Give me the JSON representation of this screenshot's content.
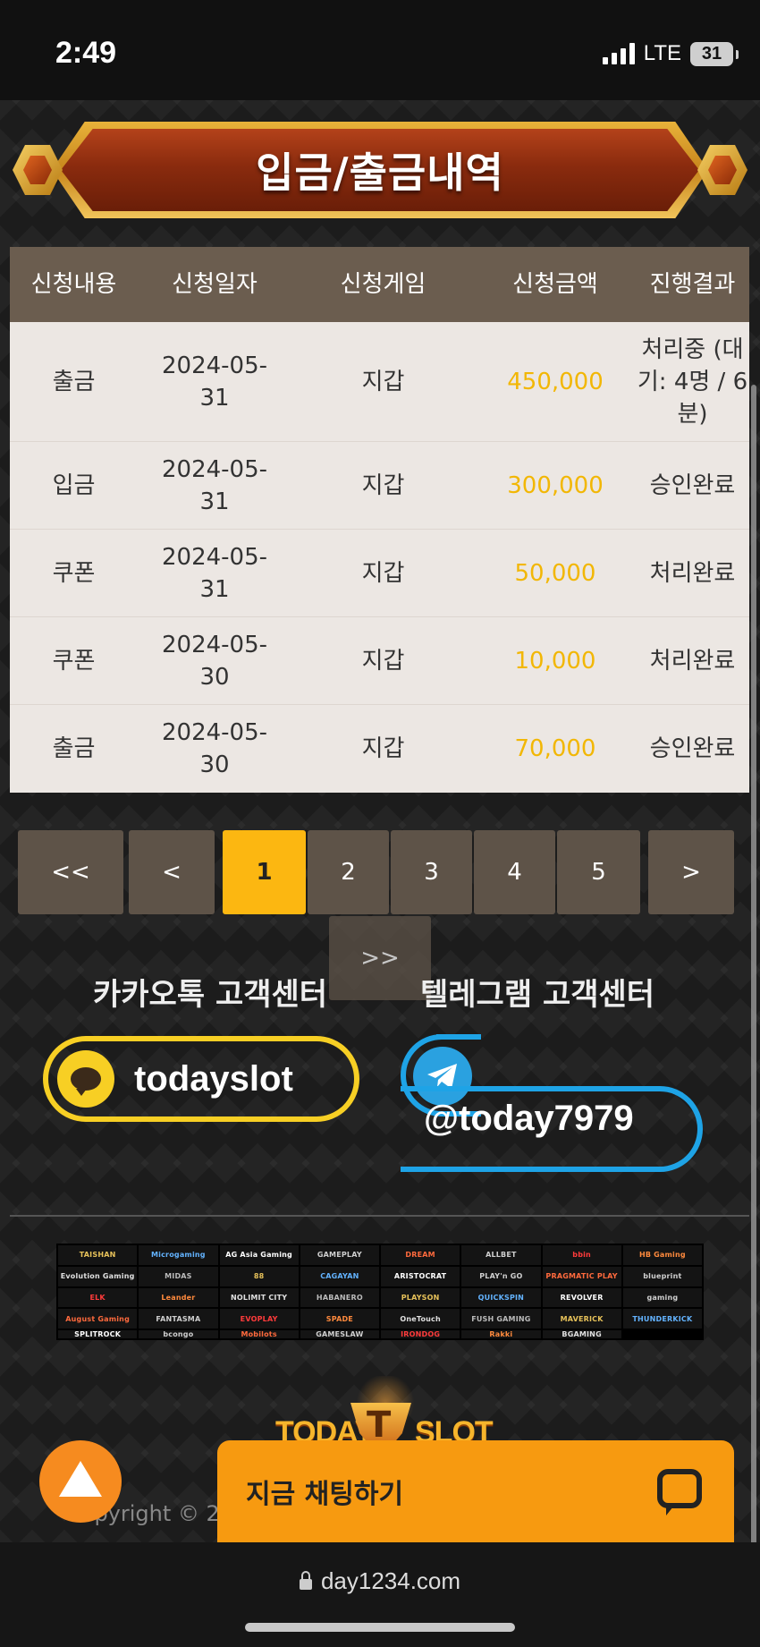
{
  "status": {
    "time": "2:49",
    "network": "LTE",
    "battery": "31"
  },
  "banner": {
    "title": "입금/출금내역"
  },
  "table": {
    "headers": [
      "신청내용",
      "신청일자",
      "신청게임",
      "신청금액",
      "진행결과"
    ],
    "rows": [
      {
        "type": "출금",
        "date": "2024-05-31",
        "game": "지갑",
        "amount": "450,000",
        "result": "처리중 (대기: 4명 / 6분)"
      },
      {
        "type": "입금",
        "date": "2024-05-31",
        "game": "지갑",
        "amount": "300,000",
        "result": "승인완료"
      },
      {
        "type": "쿠폰",
        "date": "2024-05-31",
        "game": "지갑",
        "amount": "50,000",
        "result": "처리완료"
      },
      {
        "type": "쿠폰",
        "date": "2024-05-30",
        "game": "지갑",
        "amount": "10,000",
        "result": "처리완료"
      },
      {
        "type": "출금",
        "date": "2024-05-30",
        "game": "지갑",
        "amount": "70,000",
        "result": "승인완료"
      }
    ]
  },
  "pagination": {
    "first": "<<",
    "prev": "<",
    "pages": [
      "1",
      "2",
      "3",
      "4",
      "5"
    ],
    "current": "1",
    "next": ">",
    "last": ">>"
  },
  "support": {
    "kakao_title": "카카오톡 고객센터",
    "kakao_id": "todayslot",
    "telegram_title": "텔레그램 고객센터",
    "telegram_id": "@today7979"
  },
  "providers": [
    "TAISHAN",
    "Microgaming",
    "AG Asia Gaming",
    "GAMEPLAY",
    "DREAM",
    "ALLBET",
    "bbin",
    "HB Gaming",
    "Evolution Gaming",
    "MIDAS",
    "88",
    "CAGAYAN",
    "ARISTOCRAT",
    "PLAY'n GO",
    "PRAGMATIC PLAY",
    "blueprint",
    "ELK",
    "Leander",
    "NOLIMIT CITY",
    "HABANERO",
    "PLAYSON",
    "QUICKSPIN",
    "REVOLVER",
    "gaming",
    "August Gaming",
    "FANTASMA",
    "EVOPLAY",
    "SPADE",
    "OneTouch",
    "FUSH GAMING",
    "MAVERICK",
    "THUNDERKICK",
    "SPLITROCK",
    "bcongo",
    "Mobilots",
    "GAMESLAW",
    "IRONDOG",
    "Rakki",
    "BGAMING"
  ],
  "footer": {
    "logo_left": "TODAY",
    "logo_right": "SLOT",
    "copyright": "Copyright © 2"
  },
  "chat": {
    "label": "지금 채팅하기"
  },
  "browser": {
    "url": "day1234.com"
  },
  "colors": {
    "accent": "#fcb711",
    "chat": "#f79a10",
    "kakao": "#f7cf24",
    "telegram": "#1ea3e6",
    "table_header": "#6b5d4f",
    "amount": "#f2b705"
  }
}
